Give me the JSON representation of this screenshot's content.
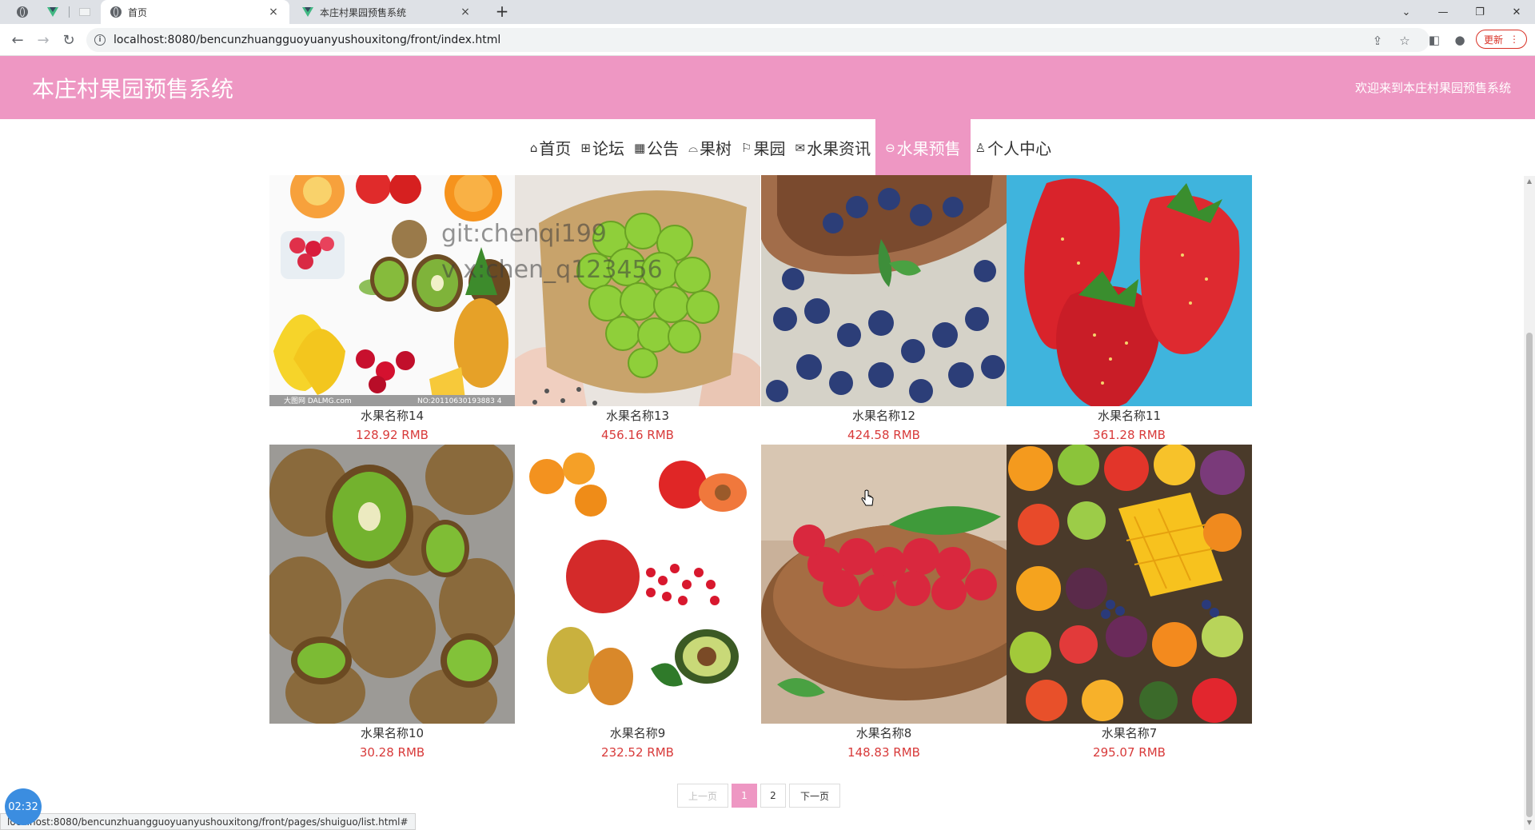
{
  "browser": {
    "tabs": [
      {
        "title": "首页",
        "close": "×",
        "active": true
      },
      {
        "title": "本庄村果园预售系统",
        "close": "×",
        "active": false
      }
    ],
    "new_tab": "+",
    "url": "localhost:8080/bencunzhuangguoyuanyushouxitong/front/index.html",
    "update_label": "更新",
    "status_url": "localhost:8080/bencunzhuangguoyuanyushouxitong/front/pages/shuiguo/list.html#"
  },
  "header": {
    "title": "本庄村果园预售系统",
    "welcome": "欢迎来到本庄村果园预售系统"
  },
  "nav": {
    "items": [
      {
        "label": "首页",
        "icon": "home-icon",
        "glyph": "⌂"
      },
      {
        "label": "论坛",
        "icon": "forum-icon",
        "glyph": "⊞"
      },
      {
        "label": "公告",
        "icon": "notice-icon",
        "glyph": "▦"
      },
      {
        "label": "果树",
        "icon": "tree-icon",
        "glyph": "⌓"
      },
      {
        "label": "果园",
        "icon": "flag-icon",
        "glyph": "⚐"
      },
      {
        "label": "水果资讯",
        "icon": "mail-icon",
        "glyph": "✉"
      },
      {
        "label": "水果预售",
        "icon": "presale-icon",
        "glyph": "⊖"
      },
      {
        "label": "个人中心",
        "icon": "user-icon",
        "glyph": "♙"
      }
    ],
    "active_index": 6
  },
  "products": [
    {
      "name": "水果名称14",
      "price": "128.92 RMB",
      "image": "mixed-fruit"
    },
    {
      "name": "水果名称13",
      "price": "456.16 RMB",
      "image": "green-grapes"
    },
    {
      "name": "水果名称12",
      "price": "424.58 RMB",
      "image": "blueberries"
    },
    {
      "name": "水果名称11",
      "price": "361.28 RMB",
      "image": "strawberries"
    },
    {
      "name": "水果名称10",
      "price": "30.28 RMB",
      "image": "kiwi"
    },
    {
      "name": "水果名称9",
      "price": "232.52 RMB",
      "image": "assorted-fruit"
    },
    {
      "name": "水果名称8",
      "price": "148.83 RMB",
      "image": "raspberries"
    },
    {
      "name": "水果名称7",
      "price": "295.07 RMB",
      "image": "fruit-platter"
    }
  ],
  "image_captions": {
    "mixed_left": "大图网 DALMG.com",
    "mixed_right": "NO:20110630193883 4"
  },
  "watermark": {
    "line1": "git:chenqi199",
    "line2": "v x:chen_q123456"
  },
  "pager": {
    "prev": "上一页",
    "pages": [
      "1",
      "2"
    ],
    "current": "1",
    "next": "下一页"
  },
  "timer": "02:32",
  "colors": {
    "accent": "#ee97c3",
    "price": "#d83a3a"
  }
}
